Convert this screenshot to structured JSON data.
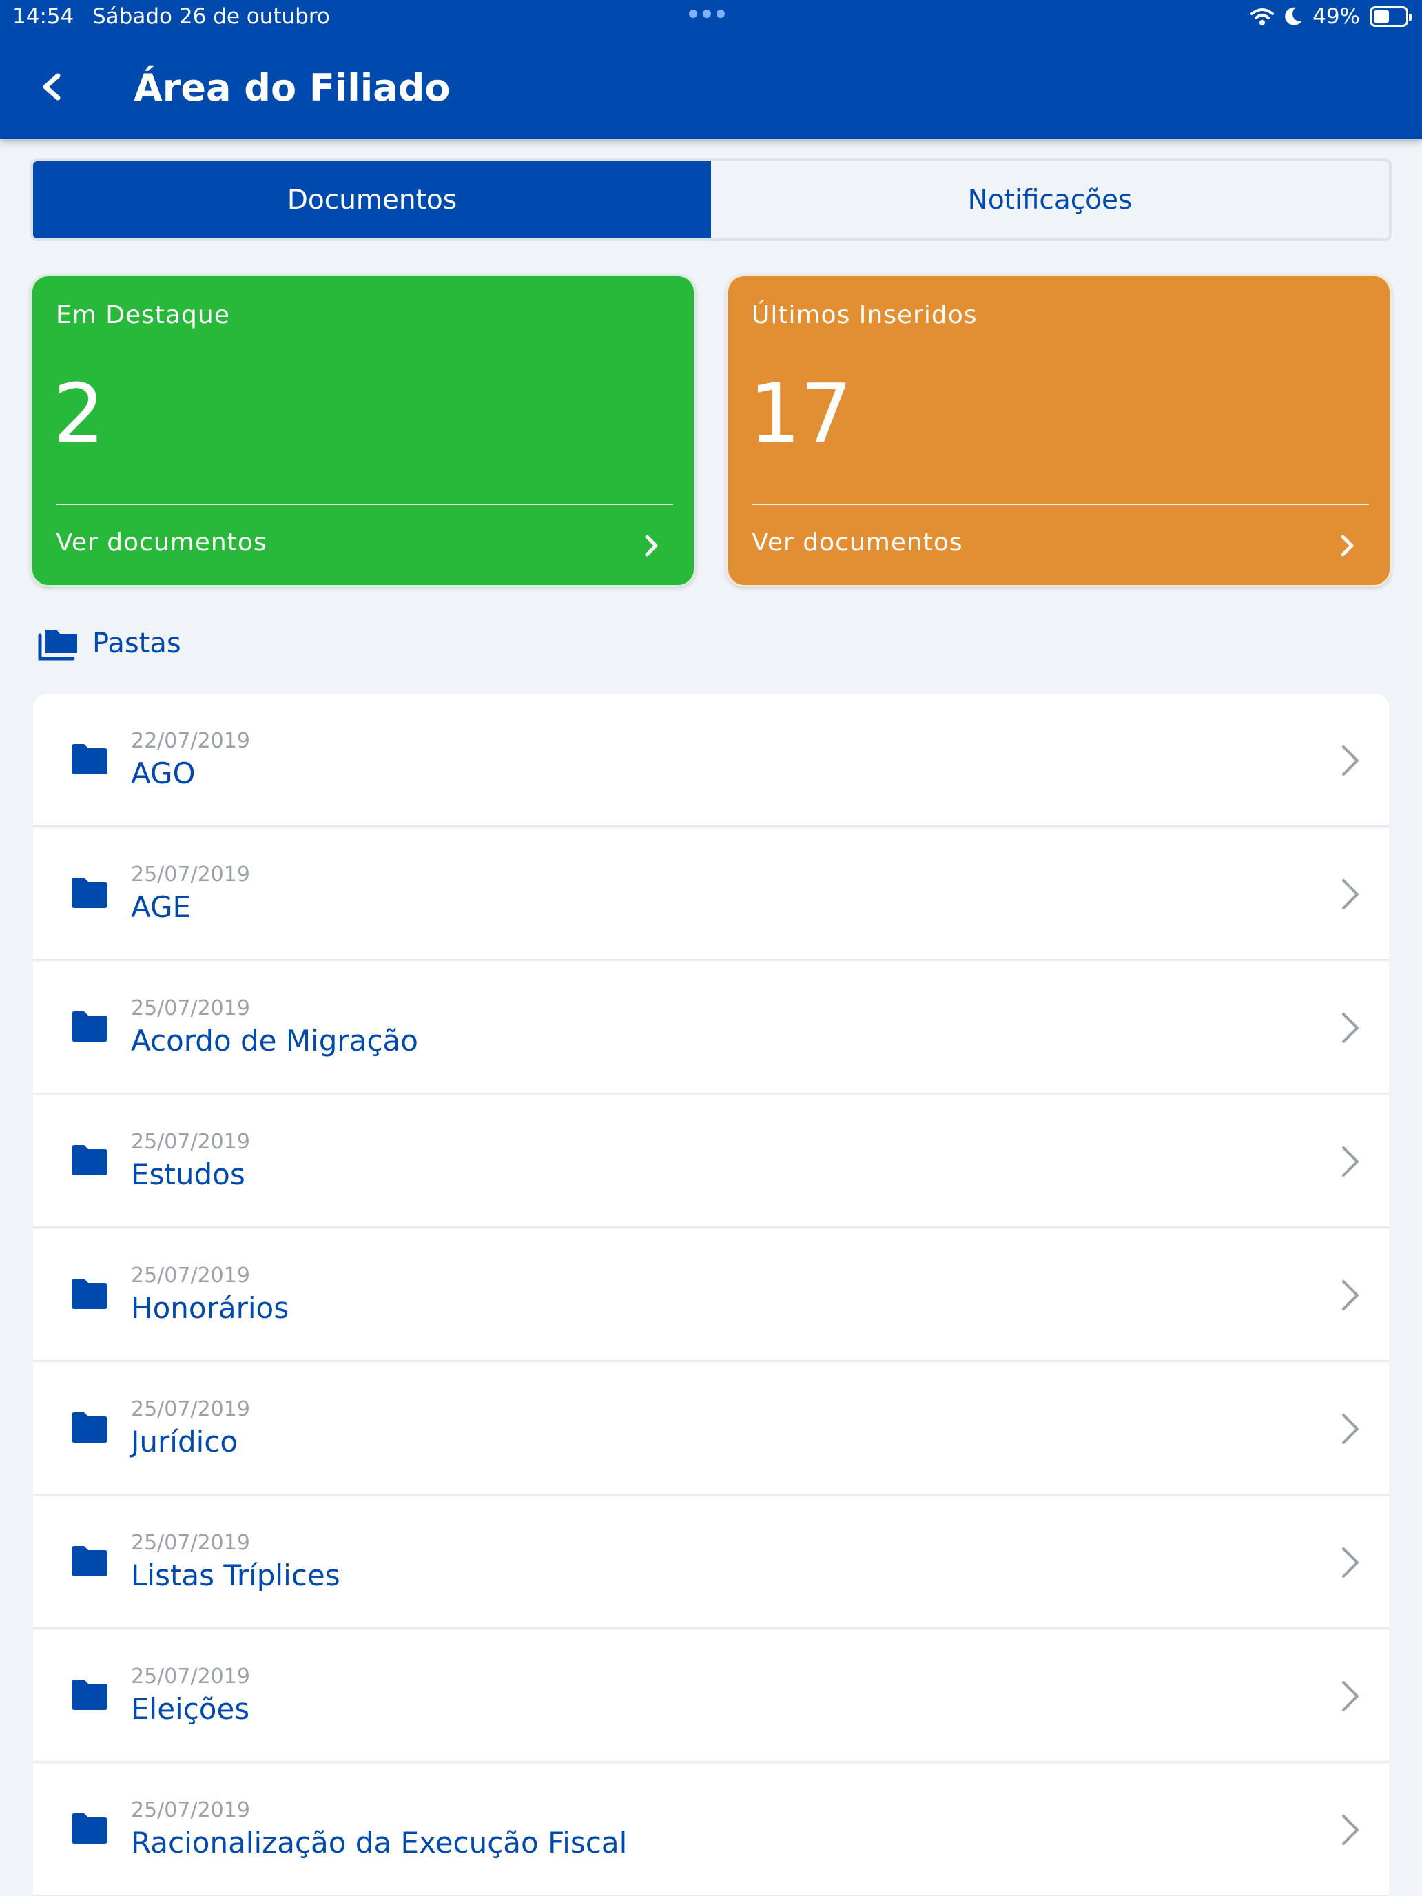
{
  "status": {
    "time": "14:54",
    "date": "Sábado 26 de outubro",
    "battery": "49%"
  },
  "header": {
    "title": "Área do Filiado"
  },
  "tabs": [
    {
      "label": "Documentos",
      "active": true
    },
    {
      "label": "Notificações",
      "active": false
    }
  ],
  "cards": {
    "highlight": {
      "label": "Em Destaque",
      "count": "2",
      "link": "Ver documentos",
      "color": "#28B83A"
    },
    "recent": {
      "label": "Últimos Inseridos",
      "count": "17",
      "link": "Ver documentos",
      "color": "#E28E33"
    }
  },
  "folders_section": {
    "title": "Pastas"
  },
  "folders": [
    {
      "date": "22/07/2019",
      "name": "AGO"
    },
    {
      "date": "25/07/2019",
      "name": "AGE"
    },
    {
      "date": "25/07/2019",
      "name": "Acordo de Migração"
    },
    {
      "date": "25/07/2019",
      "name": "Estudos"
    },
    {
      "date": "25/07/2019",
      "name": "Honorários"
    },
    {
      "date": "25/07/2019",
      "name": "Jurídico"
    },
    {
      "date": "25/07/2019",
      "name": "Listas Tríplices"
    },
    {
      "date": "25/07/2019",
      "name": "Eleições"
    },
    {
      "date": "25/07/2019",
      "name": "Racionalização da Execução Fiscal"
    }
  ],
  "colors": {
    "primary": "#004AAD",
    "background": "#F0F3F8"
  }
}
